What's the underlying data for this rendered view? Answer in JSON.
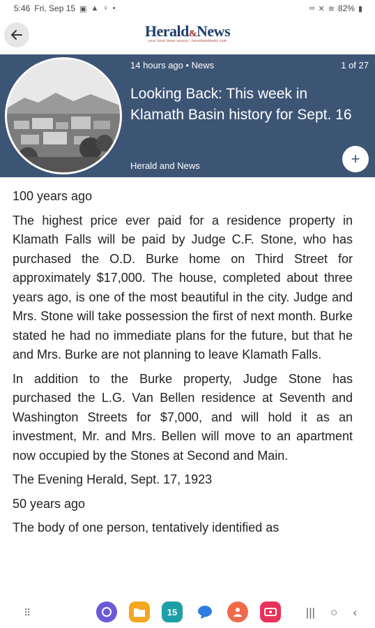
{
  "status_bar": {
    "time": "5:46",
    "date": "Fri, Sep 15",
    "battery": "82%"
  },
  "header": {
    "logo_text": "Herald",
    "logo_amp": "&",
    "logo_text2": "News",
    "logo_tagline": "your local news source | heraldandnews.com",
    "back_icon": "arrow-left-icon"
  },
  "hero": {
    "meta": "14 hours ago • News",
    "count": "1 of 27",
    "title": "Looking Back: This week in Klamath Basin history for Sept. 16",
    "source": "Herald and News",
    "add_label": "+"
  },
  "article": {
    "sections": [
      "100 years ago",
      "The highest price ever paid for a residence property in Klamath Falls will be paid by Judge C.F. Stone, who has purchased the O.D. Burke home on Third Street for approximately $17,000. The house, completed about three years ago, is one of the most beautiful in the city. Judge and Mrs. Stone will take possession the first of next month. Burke stated he had no immediate plans for the future, but that he and Mrs. Burke are not planning to leave Klamath Falls.",
      "In addition to the Burke property, Judge Stone has purchased the L.G. Van Bellen residence at Seventh and Washington Streets for $7,000, and will hold it as an investment, Mr. and Mrs. Bellen will move to an apartment now occupied by the Stones at Second and Main.",
      "The Evening Herald, Sept. 17, 1923",
      "50 years ago",
      "The body of one person, tentatively identified as"
    ]
  },
  "nav": {
    "dock_apps": [
      {
        "icon": "internet-icon",
        "color": "#6a5ad6"
      },
      {
        "icon": "my-files-icon",
        "color": "#f5a623"
      },
      {
        "icon": "calendar-icon",
        "color": "#1e9fa8"
      },
      {
        "icon": "messages-icon",
        "color": "#2f7de1"
      },
      {
        "icon": "contacts-icon",
        "color": "#f06a4a"
      },
      {
        "icon": "screen-recorder-icon",
        "color": "#e8325a"
      }
    ],
    "calendar_day": "15"
  }
}
